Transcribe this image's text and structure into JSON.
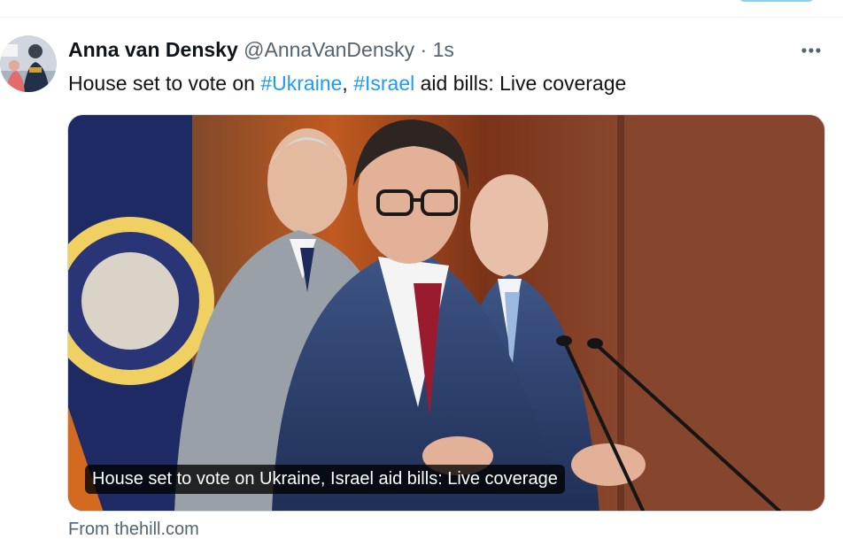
{
  "tweet": {
    "author_name": "Anna van Densky",
    "handle": "@AnnaVanDensky",
    "separator": "·",
    "time": "1s",
    "more_icon": "more-horizontal-icon",
    "text_parts": {
      "before": "House set to vote on ",
      "hashtag1": "#Ukraine",
      "comma": ", ",
      "hashtag2": "#Israel",
      "after": " aid bills: Live coverage"
    }
  },
  "card": {
    "caption": "House set to vote on Ukraine, Israel aid bills: Live coverage",
    "source": "From thehill.com",
    "image_desc": "press-conference-photo"
  },
  "colors": {
    "hashtag": "#1d9bf0",
    "secondary_text": "#536471",
    "primary_text": "#0f1419",
    "divider": "#eff3f4"
  }
}
